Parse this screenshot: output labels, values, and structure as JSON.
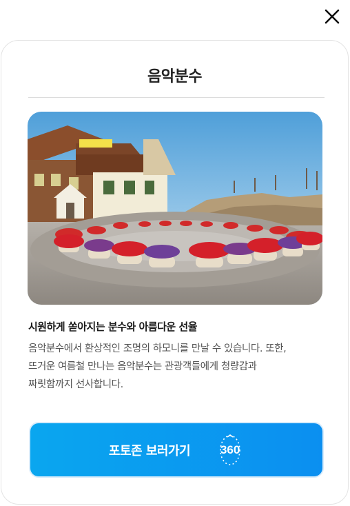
{
  "modal": {
    "title": "음악분수",
    "subtitle": "시원하게 쏟아지는 분수와 아름다운 선율",
    "description": "음악분수에서 환상적인 조명의 하모니를 만날 수 있습니다. 또한,\n뜨거운 여름철 만나는 음악분수는 관광객들에게 청량감과\n짜릿함까지 선사합니다.",
    "cta_label": "포토존 보러가기",
    "badge_text": "360"
  },
  "icons": {
    "close": "close-icon",
    "panorama": "panorama-360-icon"
  },
  "colors": {
    "cta_start": "#0aa6ef",
    "cta_end": "#0b8ff0",
    "title": "#222222",
    "body_text": "#555555"
  }
}
